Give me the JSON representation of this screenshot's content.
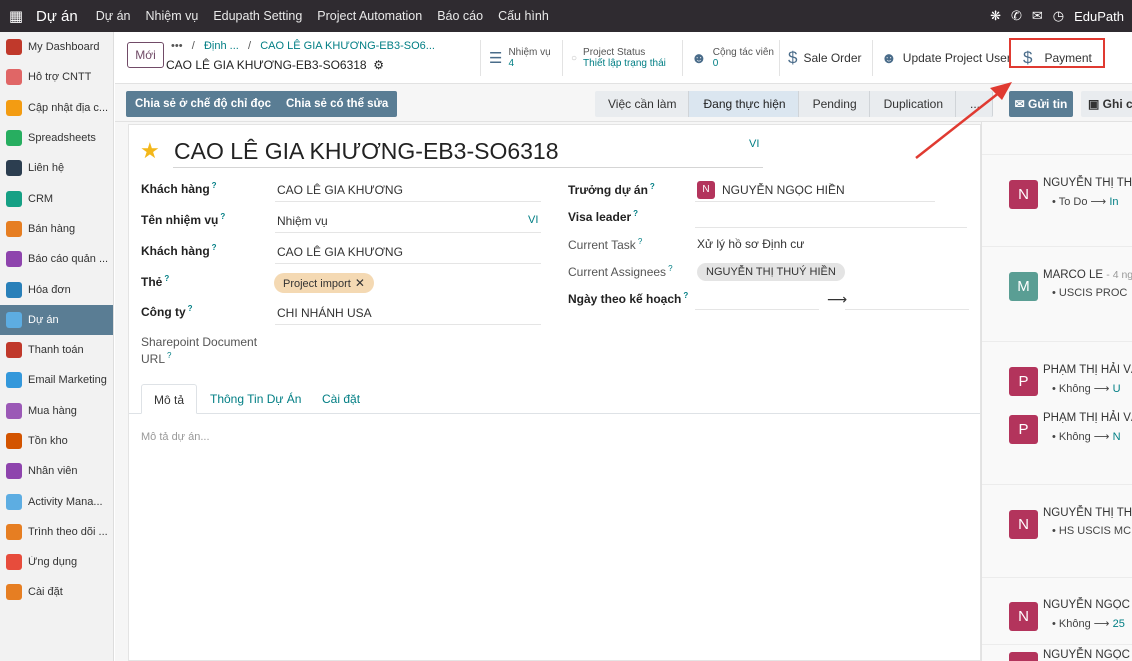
{
  "navbar": {
    "app_name": "Dự án",
    "menus": [
      "Dự án",
      "Nhiệm vụ",
      "Edupath Setting",
      "Project Automation",
      "Báo cáo",
      "Cấu hình"
    ],
    "user": "EduPath"
  },
  "sidebar": {
    "items": [
      {
        "label": "My Dashboard",
        "color": "#c0392b"
      },
      {
        "label": "Hỗ trợ CNTT",
        "color": "#e06666"
      },
      {
        "label": "Cập nhật địa c...",
        "color": "#f39c12"
      },
      {
        "label": "Spreadsheets",
        "color": "#27ae60"
      },
      {
        "label": "Liên hệ",
        "color": "#2c3e50"
      },
      {
        "label": "CRM",
        "color": "#16a085"
      },
      {
        "label": "Bán hàng",
        "color": "#e67e22"
      },
      {
        "label": "Báo cáo quản ...",
        "color": "#8e44ad"
      },
      {
        "label": "Hóa đơn",
        "color": "#2980b9"
      },
      {
        "label": "Dự án",
        "color": "#5dade2"
      },
      {
        "label": "Thanh toán",
        "color": "#c0392b"
      },
      {
        "label": "Email Marketing",
        "color": "#3498db"
      },
      {
        "label": "Mua hàng",
        "color": "#9b59b6"
      },
      {
        "label": "Tồn kho",
        "color": "#d35400"
      },
      {
        "label": "Nhân viên",
        "color": "#8e44ad"
      },
      {
        "label": "Activity Mana...",
        "color": "#5dade2"
      },
      {
        "label": "Trình theo dõi ...",
        "color": "#e67e22"
      },
      {
        "label": "Ứng dụng",
        "color": "#e74c3c"
      },
      {
        "label": "Cài đặt",
        "color": "#e67e22"
      }
    ],
    "active_index": 9
  },
  "control": {
    "new_label": "Mới",
    "crumb_dots": "•••",
    "crumb_1": "Định ...",
    "crumb_2": "CAO LÊ GIA KHƯƠNG-EB3-SO6...",
    "record_title": "CAO LÊ GIA KHƯƠNG-EB3-SO6318",
    "stats": {
      "tasks_label": "Nhiệm vụ",
      "tasks_value": "4",
      "status_label": "Project Status",
      "status_value": "Thiết lập trạng thái",
      "collab_label": "Cộng tác viên",
      "collab_value": "0",
      "sale_order": "Sale Order",
      "update_user": "Update Project User",
      "payment": "Payment"
    }
  },
  "statusbar": {
    "share_readonly": "Chia sẻ ở chế độ chỉ đọc",
    "share_edit": "Chia sẻ có thể sửa",
    "stages": [
      "Việc cần làm",
      "Đang thực hiện",
      "Pending",
      "Duplication",
      "..."
    ],
    "current_stage": 1,
    "send_message": "Gửi tin",
    "log_note": "Ghi ch"
  },
  "form": {
    "name": "CAO LÊ GIA KHƯƠNG-EB3-SO6318",
    "lang": "VI",
    "fields_left": {
      "customer1_label": "Khách hàng",
      "customer1_value": "CAO LÊ GIA KHƯƠNG",
      "task_name_label": "Tên nhiệm vụ",
      "task_name_value": "Nhiệm vụ",
      "customer2_label": "Khách hàng",
      "customer2_value": "CAO LÊ GIA KHƯƠNG",
      "tags_label": "Thẻ",
      "tag_value": "Project import",
      "company_label": "Công ty",
      "company_value": "CHI NHÁNH USA",
      "sharepoint_label_1": "Sharepoint Document",
      "sharepoint_label_2": "URL"
    },
    "fields_right": {
      "manager_label": "Trưởng dự án",
      "manager_value": "NGUYỄN NGỌC HIỀN",
      "manager_initial": "N",
      "visa_label": "Visa leader",
      "current_task_label": "Current Task",
      "current_task_value": "Xử lý hồ sơ Định cư",
      "assignees_label": "Current Assignees",
      "assignee_value": "NGUYỄN THỊ THUÝ HIỀN",
      "planned_date_label": "Ngày theo kế hoạch"
    },
    "tabs": [
      "Mô tả",
      "Thông Tin Dự Án",
      "Cài đặt"
    ],
    "description_placeholder": "Mô tả dự án..."
  },
  "chatter": {
    "messages": [
      {
        "initial": "N",
        "color": "#b3345c",
        "name": "NGUYỄN THỊ THU",
        "date": "",
        "line": "To Do",
        "tail": "In"
      },
      {
        "initial": "M",
        "color": "#5a9e94",
        "name": "MARCO LE",
        "date": "- 4 ng",
        "line": "USCIS PROC",
        "tail": ""
      },
      {
        "initial": "P",
        "color": "#b3345c",
        "name": "PHẠM THỊ HẢI VÂ",
        "date": "",
        "line": "Không",
        "tail": "U"
      },
      {
        "initial": "P",
        "color": "#b3345c",
        "name": "PHẠM THỊ HẢI VÂ",
        "date": "",
        "line": "Không",
        "tail": "N"
      },
      {
        "initial": "N",
        "color": "#b3345c",
        "name": "NGUYỄN THỊ THU",
        "date": "",
        "line": "HS USCIS MC",
        "tail": ""
      },
      {
        "initial": "N",
        "color": "#b3345c",
        "name": "NGUYỄN NGỌC H",
        "date": "",
        "line": "Không",
        "tail": "25"
      },
      {
        "initial": "N",
        "color": "#b3345c",
        "name": "NGUYỄN NGỌC H",
        "date": "",
        "line": "",
        "tail": ""
      }
    ]
  },
  "colors": {
    "navbar": "#2f2b30",
    "accent": "#5a7d94",
    "link": "#017e84",
    "highlight_box": "#e03a31",
    "star": "#f3b71a"
  }
}
